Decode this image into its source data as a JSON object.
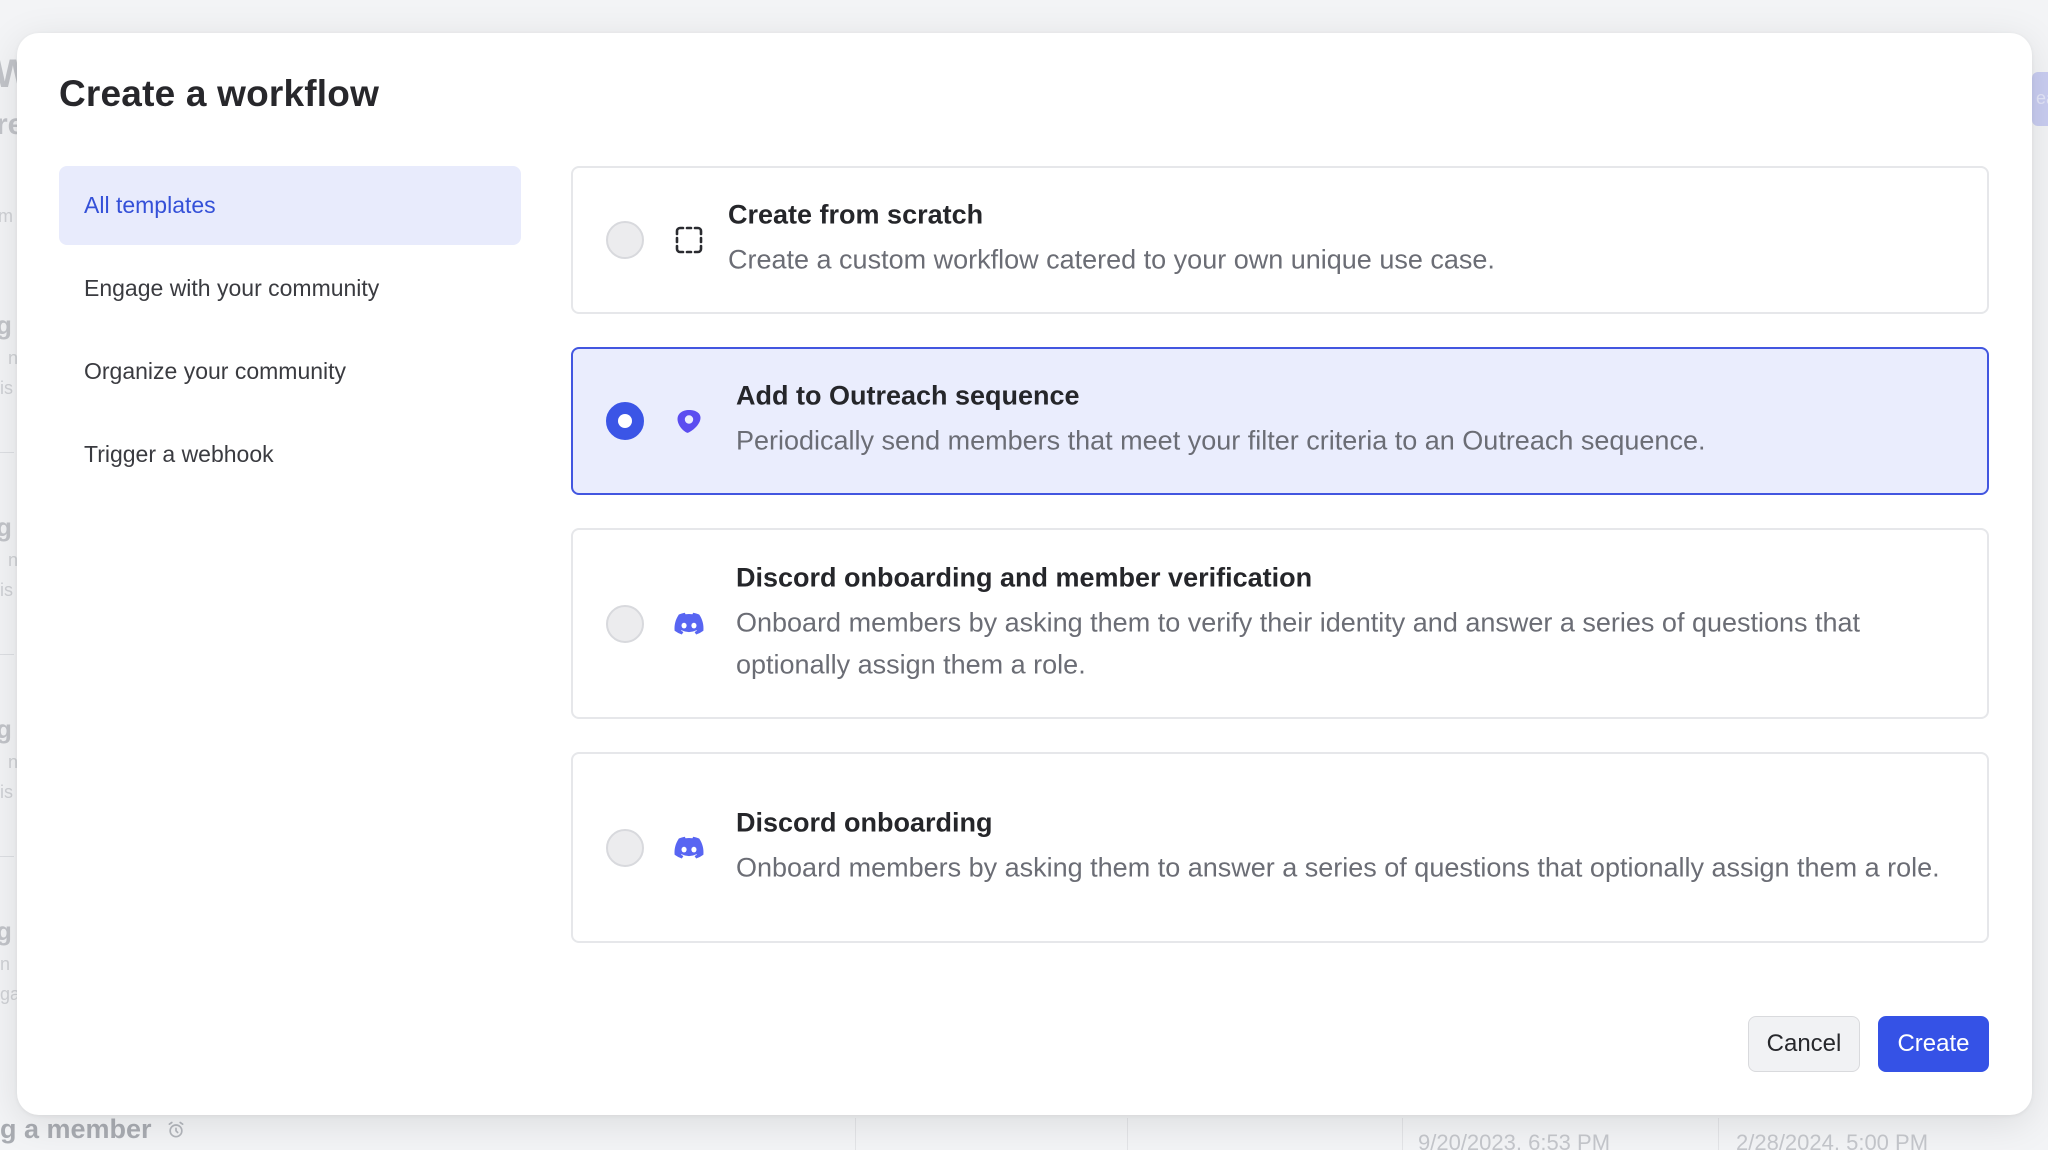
{
  "background": {
    "bottom_label": "g a member",
    "dates": [
      "9/20/2023, 6:53 PM",
      "2/28/2024, 5:00 PM"
    ],
    "fragments": [
      "W",
      "re",
      "m",
      "g",
      "n",
      "is",
      "g",
      "n",
      "is",
      "g",
      "n",
      "is",
      "g",
      "n",
      "ga",
      "ea"
    ]
  },
  "modal": {
    "title": "Create a workflow",
    "sidebar": {
      "items": [
        {
          "label": "All templates",
          "active": true
        },
        {
          "label": "Engage with your community",
          "active": false
        },
        {
          "label": "Organize your community",
          "active": false
        },
        {
          "label": "Trigger a webhook",
          "active": false
        }
      ]
    },
    "templates": [
      {
        "title": "Create from scratch",
        "description": "Create a custom workflow catered to your own unique use case.",
        "icon": "dashed-square-icon",
        "selected": false
      },
      {
        "title": "Add to Outreach sequence",
        "description": "Periodically send members that meet your filter criteria to an Outreach sequence.",
        "icon": "outreach-icon",
        "selected": true
      },
      {
        "title": "Discord onboarding and member verification",
        "description": "Onboard members by asking them to verify their identity and answer a series of questions that optionally assign them a role.",
        "icon": "discord-icon",
        "selected": false
      },
      {
        "title": "Discord onboarding",
        "description": "Onboard members by asking them to answer a series of questions that optionally assign them a role.",
        "icon": "discord-icon",
        "selected": false
      }
    ],
    "footer": {
      "cancel_label": "Cancel",
      "create_label": "Create"
    }
  },
  "colors": {
    "accent": "#3552e6",
    "selected_bg": "#eaedfd",
    "discord": "#5865f2",
    "outreach": "#5b4df0"
  }
}
